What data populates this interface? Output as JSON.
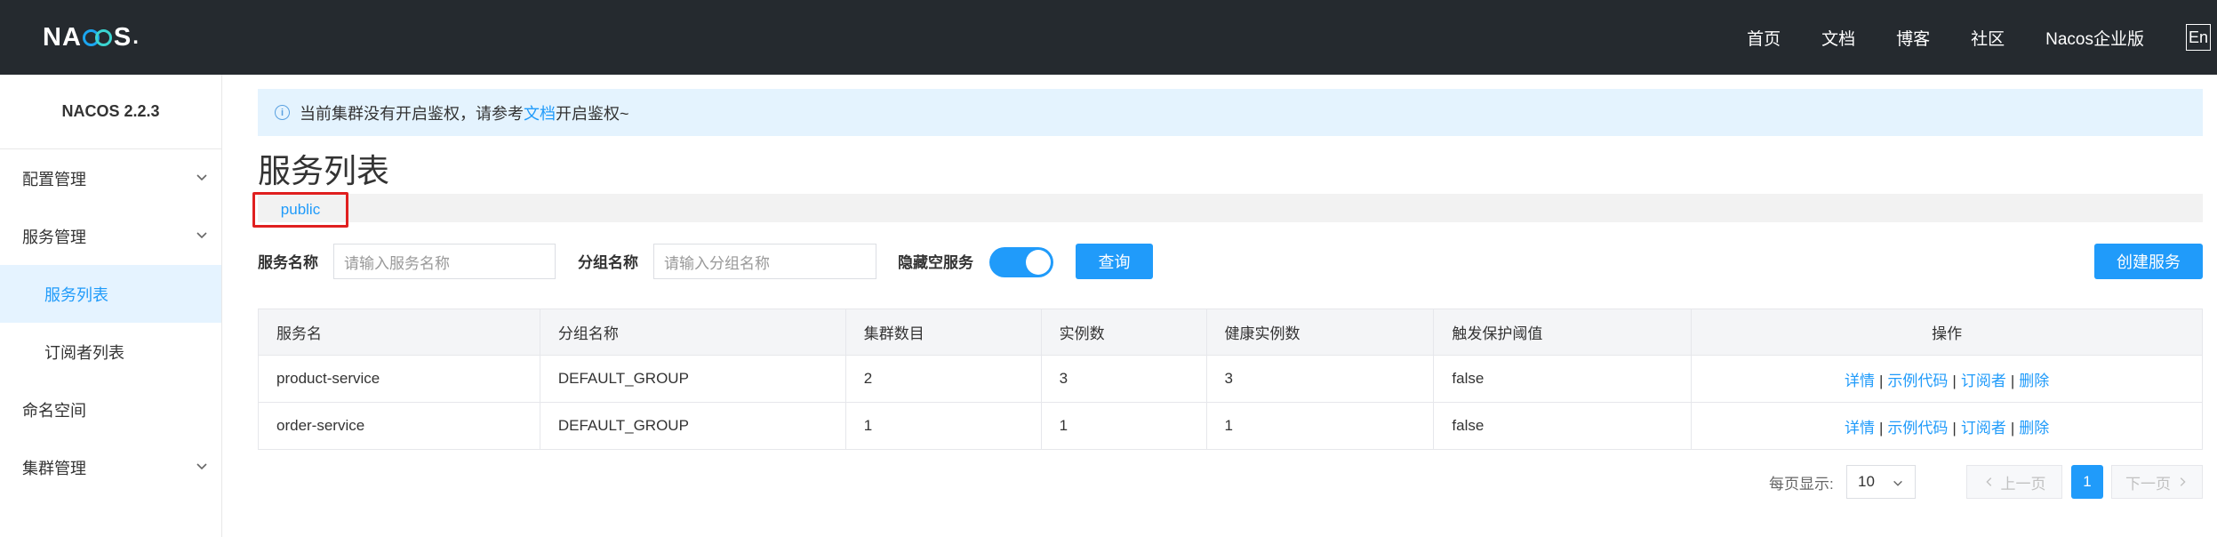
{
  "header": {
    "logo": "NACOS",
    "nav": [
      "首页",
      "文档",
      "博客",
      "社区",
      "Nacos企业版"
    ],
    "lang": "En"
  },
  "sidebar": {
    "version": "NACOS 2.2.3",
    "items": [
      {
        "label": "配置管理",
        "has_children": true
      },
      {
        "label": "服务管理",
        "has_children": true
      },
      {
        "label": "服务列表",
        "active": true
      },
      {
        "label": "订阅者列表"
      },
      {
        "label": "命名空间"
      },
      {
        "label": "集群管理",
        "has_children": true
      }
    ]
  },
  "notice": {
    "prefix": "当前集群没有开启鉴权，请参考",
    "link": "文档",
    "suffix": "开启鉴权~"
  },
  "page": {
    "title": "服务列表",
    "namespace": "public"
  },
  "filters": {
    "service_name_label": "服务名称",
    "service_name_placeholder": "请输入服务名称",
    "group_name_label": "分组名称",
    "group_name_placeholder": "请输入分组名称",
    "hide_empty_label": "隐藏空服务",
    "hide_empty_on": true,
    "query_button": "查询",
    "create_button": "创建服务"
  },
  "table": {
    "columns": [
      "服务名",
      "分组名称",
      "集群数目",
      "实例数",
      "健康实例数",
      "触发保护阈值",
      "操作"
    ],
    "rows": [
      {
        "name": "product-service",
        "group": "DEFAULT_GROUP",
        "clusters": "2",
        "instances": "3",
        "healthy": "3",
        "protect": "false"
      },
      {
        "name": "order-service",
        "group": "DEFAULT_GROUP",
        "clusters": "1",
        "instances": "1",
        "healthy": "1",
        "protect": "false"
      }
    ],
    "actions": [
      "详情",
      "示例代码",
      "订阅者",
      "删除"
    ]
  },
  "pagination": {
    "page_size_label": "每页显示:",
    "page_size": "10",
    "prev": "上一页",
    "current": "1",
    "next": "下一页"
  },
  "colors": {
    "accent": "#209bfa",
    "topbar": "#252a2f",
    "highlight_box": "#e02020"
  }
}
